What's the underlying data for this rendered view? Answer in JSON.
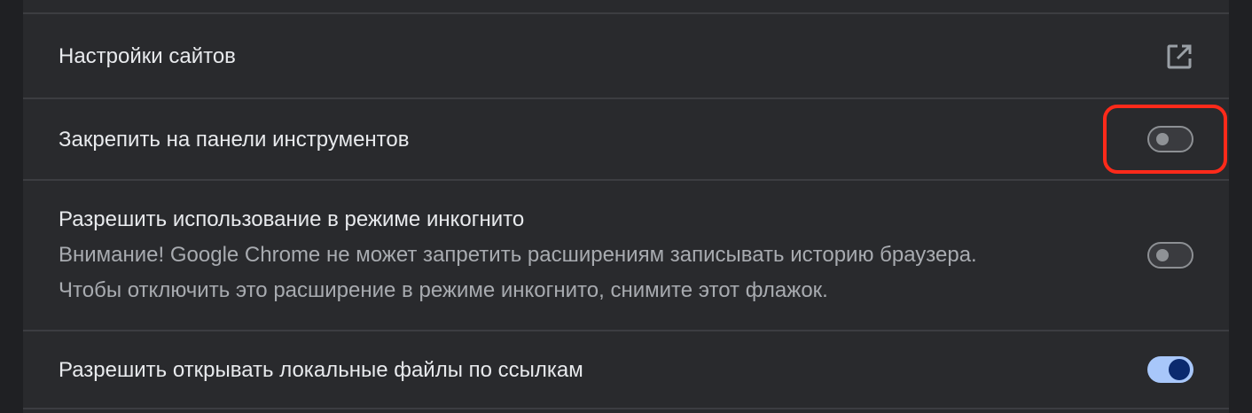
{
  "rows": [
    {
      "label": "Настройки сайтов",
      "icon": "open-in-new-icon"
    },
    {
      "label": "Закрепить на панели инструментов",
      "toggle_on": false
    },
    {
      "label": "Разрешить использование в режиме инкогнито",
      "sub1": "Внимание! Google Chrome не может запретить расширениям записывать историю браузера.",
      "sub2": "Чтобы отключить это расширение в режиме инкогнито, снимите этот флажок.",
      "toggle_on": false
    },
    {
      "label": "Разрешить открывать локальные файлы по ссылкам",
      "toggle_on": true
    }
  ],
  "colors": {
    "background": "#202124",
    "card": "#292a2d",
    "text_primary": "#e8eaed",
    "text_secondary": "#a8abb0",
    "toggle_on_track": "#a8c7fa",
    "toggle_on_knob": "#0b2a6e",
    "highlight": "#ff2a1a"
  }
}
